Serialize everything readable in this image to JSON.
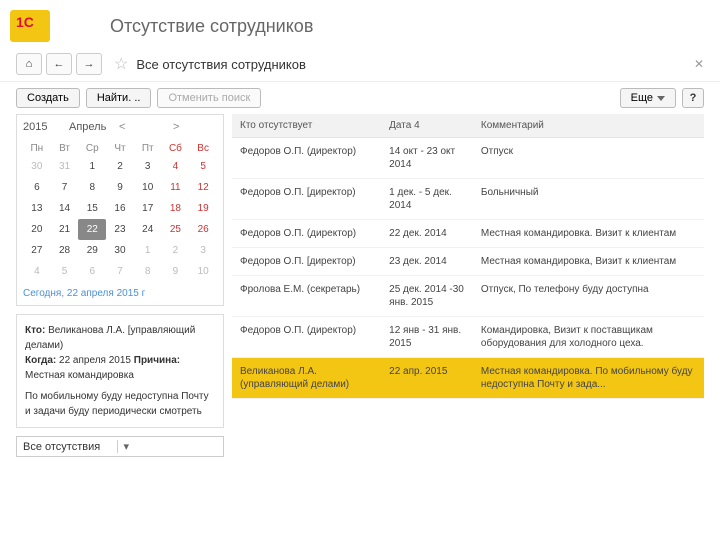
{
  "page": {
    "title": "Отсутствие сотрудников",
    "subtitle": "Все отсутствия сотрудников"
  },
  "actions": {
    "create": "Создать",
    "find": "Найти. ..",
    "cancel_search": "Отменить поиск",
    "more": "Еще",
    "help": "?"
  },
  "calendar": {
    "year": "2015",
    "month": "Апрель",
    "dow": [
      "Пн",
      "Вт",
      "Ср",
      "Чт",
      "Пт",
      "Сб",
      "Вс"
    ],
    "weeks": [
      [
        {
          "d": "30",
          "dim": true
        },
        {
          "d": "31",
          "dim": true
        },
        {
          "d": "1"
        },
        {
          "d": "2"
        },
        {
          "d": "3"
        },
        {
          "d": "4",
          "red": true
        },
        {
          "d": "5",
          "red": true
        }
      ],
      [
        {
          "d": "6"
        },
        {
          "d": "7"
        },
        {
          "d": "8"
        },
        {
          "d": "9"
        },
        {
          "d": "10"
        },
        {
          "d": "11",
          "red": true
        },
        {
          "d": "12",
          "red": true
        }
      ],
      [
        {
          "d": "13"
        },
        {
          "d": "14"
        },
        {
          "d": "15"
        },
        {
          "d": "16"
        },
        {
          "d": "17"
        },
        {
          "d": "18",
          "red": true
        },
        {
          "d": "19",
          "red": true
        }
      ],
      [
        {
          "d": "20"
        },
        {
          "d": "21"
        },
        {
          "d": "22",
          "sel": true
        },
        {
          "d": "23"
        },
        {
          "d": "24"
        },
        {
          "d": "25",
          "red": true
        },
        {
          "d": "26",
          "red": true
        }
      ],
      [
        {
          "d": "27"
        },
        {
          "d": "28"
        },
        {
          "d": "29"
        },
        {
          "d": "30"
        },
        {
          "d": "1",
          "dim": true
        },
        {
          "d": "2",
          "dim": true
        },
        {
          "d": "3",
          "dim": true
        }
      ],
      [
        {
          "d": "4",
          "dim": true
        },
        {
          "d": "5",
          "dim": true
        },
        {
          "d": "6",
          "dim": true
        },
        {
          "d": "7",
          "dim": true
        },
        {
          "d": "8",
          "dim": true
        },
        {
          "d": "9",
          "dim": true
        },
        {
          "d": "10",
          "dim": true
        }
      ]
    ],
    "today_link": "Сегодня, 22 апреля 2015 г"
  },
  "details": {
    "who_label": "Кто:",
    "who": "Великанова Л.А. [управляющий делами)",
    "when_label": "Когда:",
    "when": "22 апреля 2015",
    "reason_label": "Причина:",
    "reason": "Местная командировка",
    "note": "По мобильному буду недоступна Почту и задачи буду периодически смотреть"
  },
  "filter": {
    "label": "Все отсутствия"
  },
  "table": {
    "headers": [
      "Кто отсутствует",
      "Дата 4",
      "Комментарий"
    ],
    "rows": [
      {
        "who": "Федоров О.П. (директор)",
        "date": "14 окт - 23 окт 2014",
        "comment": "Отпуск"
      },
      {
        "who": "Федоров О.П. [директор)",
        "date": "1 дек. - 5 дек. 2014",
        "comment": "Больничный"
      },
      {
        "who": "Федоров О.П. (директор)",
        "date": "22 дек. 2014",
        "comment": "Местная командировка. Визит к клиентам"
      },
      {
        "who": "Федоров О.П. [директор)",
        "date": "23 дек. 2014",
        "comment": "Местная командировка, Визит к клиентам"
      },
      {
        "who": "Фролова Е.М. (секретарь)",
        "date": "25 дек. 2014 -30 янв. 2015",
        "comment": "Отпуск, По телефону буду доступна"
      },
      {
        "who": "Федоров О.П. (директор)",
        "date": "12 янв - 31 янв. 2015",
        "comment": "Командировка, Визит к поставщикам оборудования для холодного цеха."
      },
      {
        "who": "Великанова Л.А. (управляющий делами)",
        "date": "22 апр. 2015",
        "comment": "Местная командировка. По мобильному буду недоступна Почту и зада...",
        "sel": true
      }
    ]
  }
}
